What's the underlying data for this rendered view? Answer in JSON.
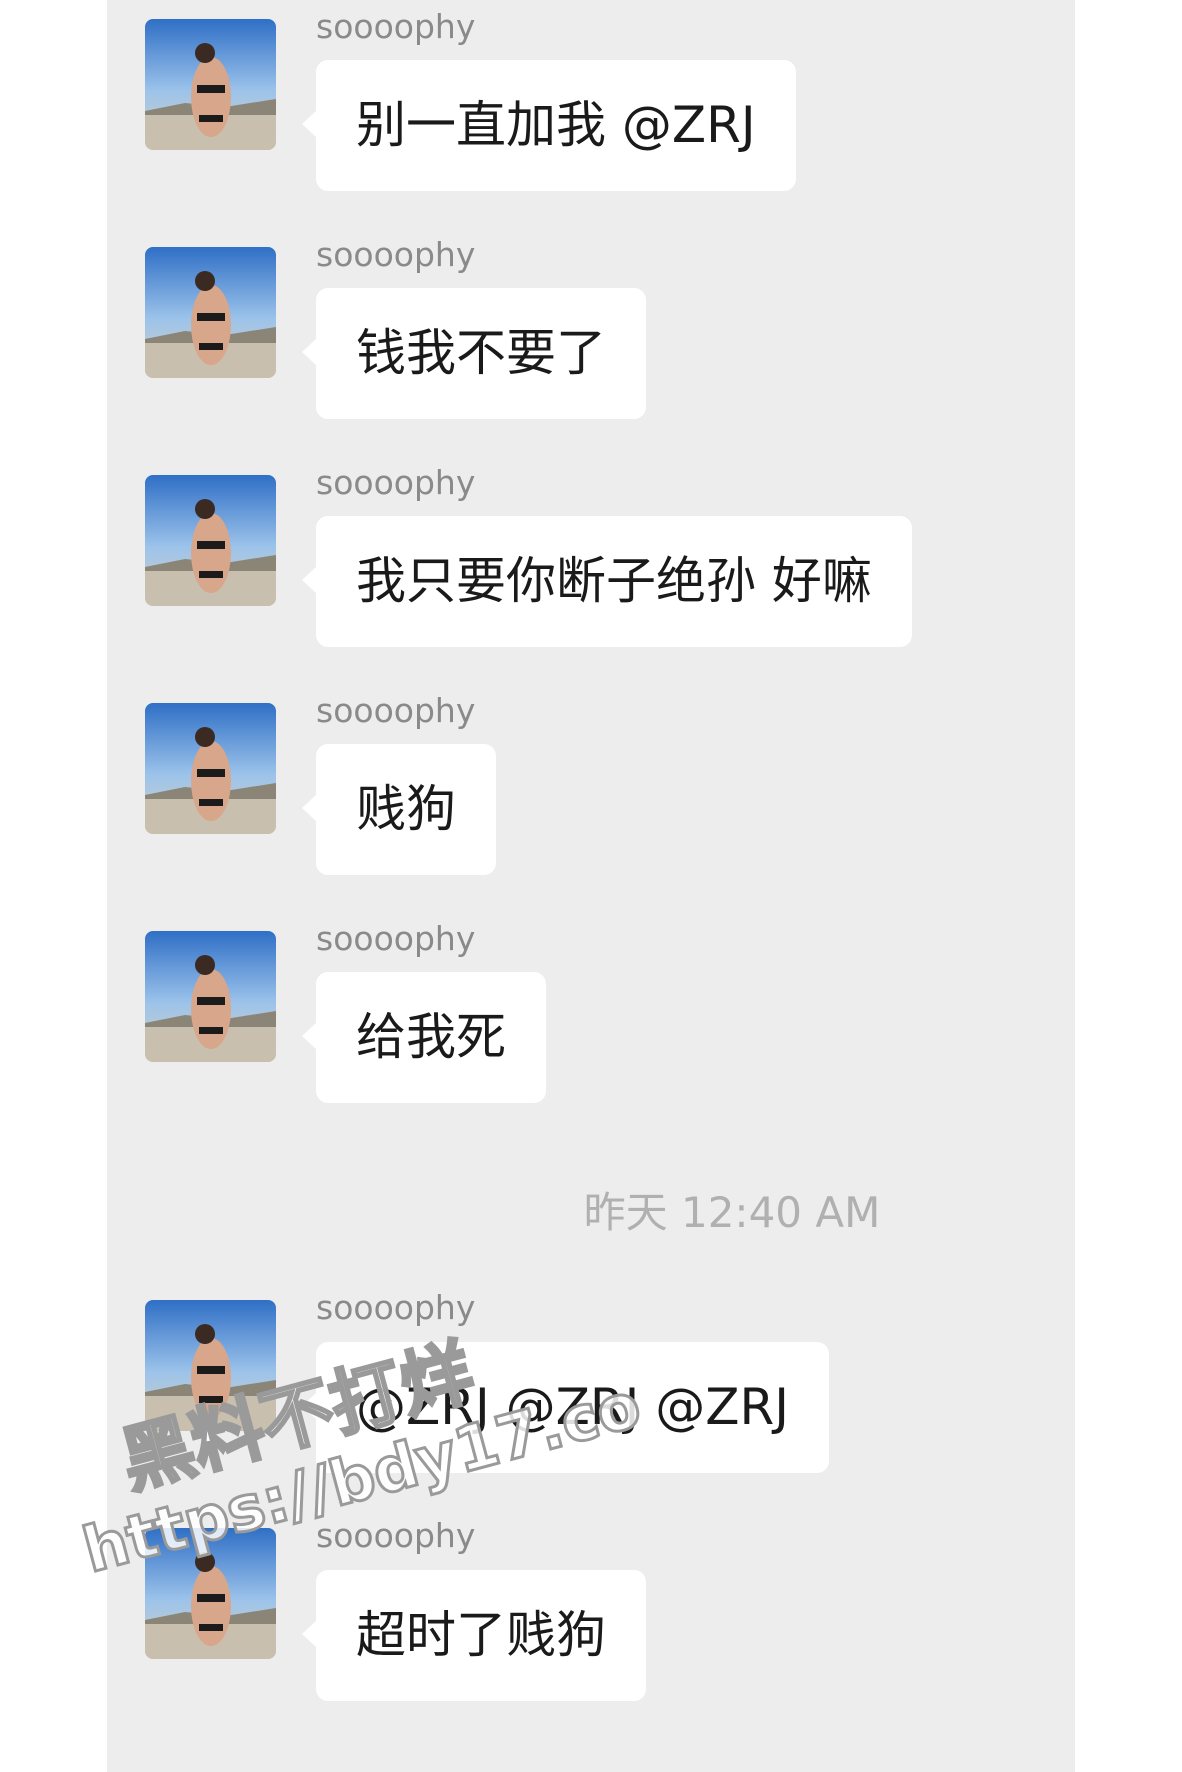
{
  "conversation": {
    "messages": [
      {
        "sender": "soooophy",
        "text": "别一直加我 @ZRJ"
      },
      {
        "sender": "soooophy",
        "text": "钱我不要了"
      },
      {
        "sender": "soooophy",
        "text": "我只要你断子绝孙 好嘛"
      },
      {
        "sender": "soooophy",
        "text": "贱狗"
      },
      {
        "sender": "soooophy",
        "text": "给我死"
      },
      {
        "sender": "soooophy",
        "text": "@ZRJ @ZRJ @ZRJ"
      },
      {
        "sender": "soooophy",
        "text": "超时了贱狗"
      }
    ],
    "timestamp": "昨天 12:40 AM"
  },
  "watermark": {
    "line1": "黑料不打烊",
    "line2": "https://bdy17.co"
  },
  "colors": {
    "chat_background": "#ededed",
    "bubble": "#ffffff",
    "sender_text": "#8a8a8a",
    "timestamp_text": "#b0b0b0"
  }
}
